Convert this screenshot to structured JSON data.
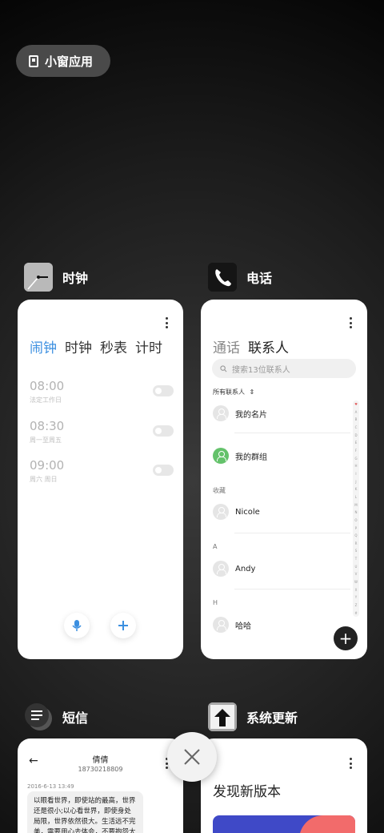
{
  "top_pill": {
    "label": "小窗应用",
    "icon": "window-icon"
  },
  "apps": {
    "clock": {
      "name": "时钟",
      "icon": "clock-icon",
      "tabs": [
        "闹钟",
        "时钟",
        "秒表",
        "计时"
      ],
      "active_tab": "闹钟",
      "alarms": [
        {
          "time": "08:00",
          "repeat": "法定工作日",
          "enabled": false
        },
        {
          "time": "08:30",
          "repeat": "周一至周五",
          "enabled": false
        },
        {
          "time": "09:00",
          "repeat": "周六 周日",
          "enabled": false
        }
      ],
      "accent_color": "#3b8fe0"
    },
    "phone": {
      "name": "电话",
      "icon": "phone-icon",
      "tabs": [
        "通话",
        "联系人"
      ],
      "active_tab": "联系人",
      "search_placeholder": "搜索13位联系人",
      "filter_label": "所有联系人",
      "my_card": "我的名片",
      "my_groups": "我的群组",
      "favorites_header": "收藏",
      "favorite_contact": "Nicole",
      "section_a": "A",
      "contact_a": "Andy",
      "section_h": "H",
      "contact_h": "哈哈",
      "index": [
        "♥",
        "A",
        "B",
        "C",
        "D",
        "E",
        "F",
        "G",
        "H",
        "I",
        "J",
        "K",
        "L",
        "M",
        "N",
        "O",
        "P",
        "Q",
        "R",
        "S",
        "T",
        "U",
        "V",
        "W",
        "X",
        "Y",
        "Z",
        "#"
      ]
    },
    "sms": {
      "name": "短信",
      "icon": "message-icon",
      "contact_name": "倩倩",
      "contact_number": "18730218809",
      "timestamp": "2016-6-13 13:49",
      "message": "以眼看世界，即使站的最高，世界还是很小;以心看世界，即使身处局限，世界依然很大。生活远不完美，需要用心去体会，不要抱怨太多"
    },
    "update": {
      "name": "系统更新",
      "icon": "update-arrow-icon",
      "headline": "发现新版本"
    }
  },
  "close_button": "close-icon"
}
